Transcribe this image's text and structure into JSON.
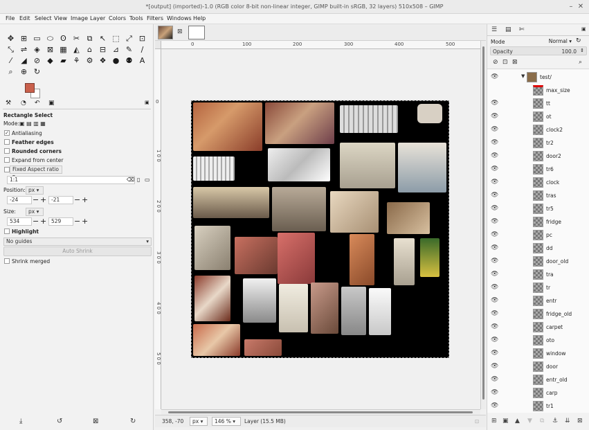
{
  "window": {
    "title": "*[output] (imported)-1.0 (RGB color 8-bit non-linear integer, GIMP built-in sRGB, 32 layers) 510x508 – GIMP",
    "minimize": "–",
    "close": "✕"
  },
  "menu": [
    "File",
    "Edit",
    "Select",
    "View",
    "Image",
    "Layer",
    "Colors",
    "Tools",
    "Filters",
    "Windows",
    "Help"
  ],
  "tools": [
    "✥",
    "⊞",
    "▭",
    "⬭",
    "ʘ",
    "✂",
    "⧉",
    "↖",
    "⬚",
    "⤢",
    "⊡",
    "⤡",
    "⇌",
    "◈",
    "⊠",
    "▦",
    "◭",
    "⌂",
    "⊟",
    "⊿",
    "✎",
    "∕",
    "⁄",
    "◢",
    "⊘",
    "◆",
    "▰",
    "⚘",
    "⚙",
    "❖",
    "●",
    "⚉",
    "A",
    "⌕",
    "⊕",
    "↻"
  ],
  "tool_options": {
    "title": "Rectangle Select",
    "mode_label": "Mode:",
    "antialiasing": "Antialiasing",
    "feather_edges": "Feather edges",
    "rounded_corners": "Rounded corners",
    "expand_from_center": "Expand from center",
    "fixed_aspect": "Fixed Aspect ratio",
    "ratio_value": "1:1",
    "position_label": "Position:",
    "position_unit": "px",
    "pos_x": "-24",
    "pos_y": "-21",
    "size_label": "Size:",
    "size_unit": "px",
    "size_w": "534",
    "size_h": "529",
    "highlight": "Highlight",
    "guides": "No guides",
    "auto_shrink": "Auto Shrink",
    "shrink_merged": "Shrink merged"
  },
  "ruler_h": [
    "0",
    "100",
    "200",
    "300",
    "400",
    "500"
  ],
  "ruler_v": [
    "0",
    "1 0 0",
    "2 0 0",
    "3 0 0",
    "4 0 0",
    "5 0 0"
  ],
  "status": {
    "coords": "358, -70",
    "unit": "px",
    "zoom": "146 %",
    "info": "Layer (15.5 MB)"
  },
  "layers_panel": {
    "mode_label": "Mode",
    "mode_value": "Normal",
    "opacity_label": "Opacity",
    "opacity_value": "100.0",
    "group": "test/",
    "layers": [
      "max_size",
      "tt",
      "ot",
      "clock2",
      "tr2",
      "door2",
      "tr6",
      "clock",
      "tras",
      "tr5",
      "fridge",
      "pc",
      "dd",
      "door_old",
      "tra",
      "tr",
      "entr",
      "fridge_old",
      "carpet",
      "oto",
      "window",
      "door",
      "entr_old",
      "carp",
      "tr1"
    ]
  },
  "colors": {
    "fg": "#c9604c",
    "bg": "#ffffff",
    "canvas": "#000000"
  }
}
